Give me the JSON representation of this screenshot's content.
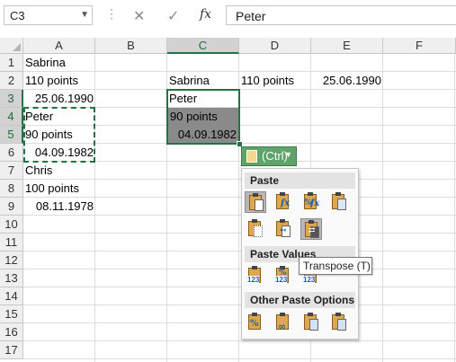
{
  "formula_bar": {
    "name_box": "C3",
    "cancel_icon": "✕",
    "enter_icon": "✓",
    "fx_icon": "fx",
    "value": "Peter"
  },
  "columns": [
    "A",
    "B",
    "C",
    "D",
    "E",
    "F"
  ],
  "selected_column": "C",
  "rows": [
    "1",
    "2",
    "3",
    "4",
    "5",
    "6",
    "7",
    "8",
    "9",
    "10",
    "11",
    "12",
    "13",
    "14",
    "15",
    "16",
    "17"
  ],
  "selected_rows": [
    "3",
    "4",
    "5"
  ],
  "cells": {
    "A1": "Sabrina",
    "A2": "110 points",
    "A3": "25.06.1990",
    "A4": "Peter",
    "A5": "90 points",
    "A6": "04.09.1982",
    "A7": "Chris",
    "A8": "100 points",
    "A9": "08.11.1978",
    "C2": "Sabrina",
    "D2": "110 points",
    "E2": "25.06.1990",
    "C3": "Peter",
    "C4": "90 points",
    "C5": "04.09.1982"
  },
  "paste_options": {
    "ctrl_label": "(Ctrl)",
    "section_paste": "Paste",
    "section_paste_values": "Paste Values",
    "section_other": "Other Paste Options",
    "tooltip": "Transpose (T)",
    "paste_icons": [
      "paste",
      "paste-formulas",
      "paste-formulas-number-formatting",
      "keep-source-formatting",
      "no-borders",
      "keep-source-column-widths",
      "transpose"
    ],
    "value_icons": [
      "values",
      "values-number-formatting",
      "values-source-formatting"
    ],
    "other_icons": [
      "formatting",
      "paste-link",
      "picture",
      "linked-picture"
    ],
    "value_glyph": "123",
    "percent_glyph": "%",
    "accent_color": "#217346"
  }
}
